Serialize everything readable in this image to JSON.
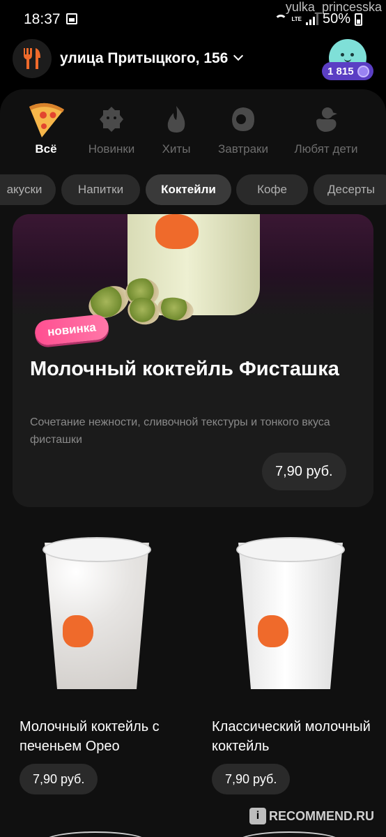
{
  "status_bar": {
    "time": "18:37",
    "battery": "50%",
    "network": "LTE",
    "watermark": "yulka_princesska"
  },
  "header": {
    "address": "улица Притыцкого, 156",
    "points": "1 815"
  },
  "categories": [
    {
      "label": "Всё",
      "icon": "pizza-icon",
      "active": true
    },
    {
      "label": "Новинки",
      "icon": "badge-icon",
      "active": false
    },
    {
      "label": "Хиты",
      "icon": "fire-icon",
      "active": false
    },
    {
      "label": "Завтраки",
      "icon": "egg-icon",
      "active": false
    },
    {
      "label": "Любят дети",
      "icon": "duck-icon",
      "active": false
    }
  ],
  "chips": [
    {
      "label": "акуски",
      "active": false
    },
    {
      "label": "Напитки",
      "active": false
    },
    {
      "label": "Коктейли",
      "active": true
    },
    {
      "label": "Кофе",
      "active": false
    },
    {
      "label": "Десерты",
      "active": false
    }
  ],
  "featured": {
    "badge": "новинка",
    "title": "Молочный коктейль Фисташка",
    "description": "Сочетание нежности, сливочной текстуры и тонкого вкуса фисташки",
    "price": "7,90 руб."
  },
  "products": [
    {
      "name": "Молочный коктейль с печеньем Орео",
      "price": "7,90 руб."
    },
    {
      "name": "Классический молочный коктейль",
      "price": "7,90 руб."
    }
  ],
  "watermark_bottom": "RECOMMEND.RU",
  "colors": {
    "background": "#000000",
    "panel": "#101010",
    "card": "#1b1b1b",
    "accent_pink": "#ff4f91",
    "points_purple": "#5b3fc4",
    "brand_orange": "#ef6a2b"
  }
}
